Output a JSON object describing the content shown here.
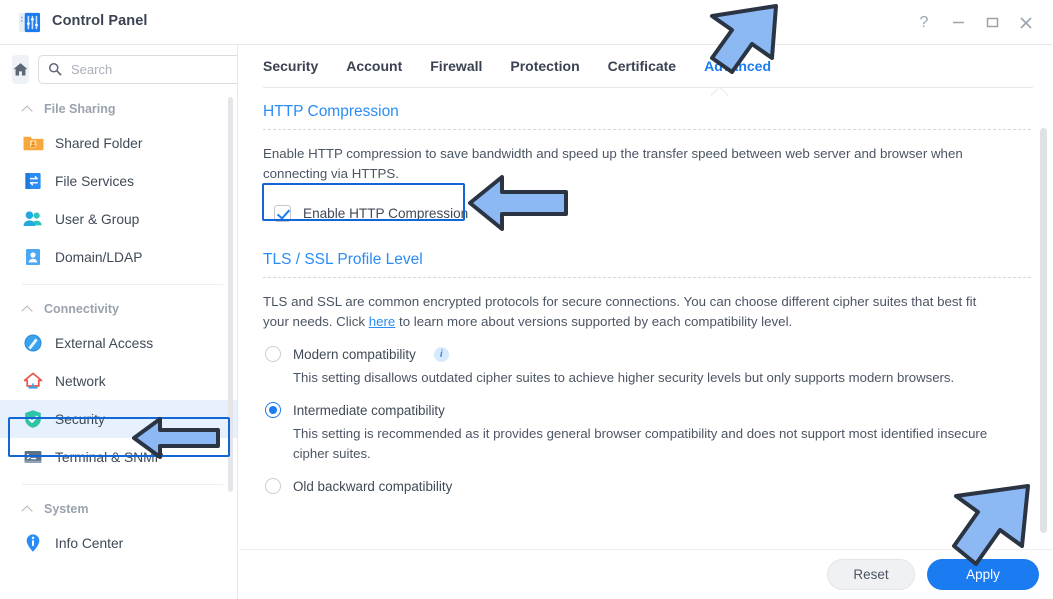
{
  "window": {
    "title": "Control Panel",
    "app_icon": "control-panel-icon",
    "controls": {
      "help": "?",
      "minimize": "minimize-icon",
      "maximize": "maximize-icon",
      "close": "close-icon"
    }
  },
  "sidebar": {
    "home_button": "home-icon",
    "search": {
      "value": "",
      "placeholder": "Search",
      "icon": "search-icon"
    },
    "groups": [
      {
        "label": "File Sharing",
        "items": [
          {
            "label": "Shared Folder",
            "icon": "shared-folder-icon",
            "active": false
          },
          {
            "label": "File Services",
            "icon": "file-services-icon",
            "active": false
          },
          {
            "label": "User & Group",
            "icon": "user-group-icon",
            "active": false
          },
          {
            "label": "Domain/LDAP",
            "icon": "domain-ldap-icon",
            "active": false
          }
        ]
      },
      {
        "label": "Connectivity",
        "items": [
          {
            "label": "External Access",
            "icon": "external-access-icon",
            "active": false
          },
          {
            "label": "Network",
            "icon": "network-icon",
            "active": false
          },
          {
            "label": "Security",
            "icon": "security-shield-icon",
            "active": true
          },
          {
            "label": "Terminal & SNMP",
            "icon": "terminal-snmp-icon",
            "active": false
          }
        ]
      },
      {
        "label": "System",
        "items": [
          {
            "label": "Info Center",
            "icon": "info-center-icon",
            "active": false
          }
        ]
      }
    ]
  },
  "main": {
    "tabs": [
      {
        "label": "Security",
        "active": false
      },
      {
        "label": "Account",
        "active": false
      },
      {
        "label": "Firewall",
        "active": false
      },
      {
        "label": "Protection",
        "active": false
      },
      {
        "label": "Certificate",
        "active": false
      },
      {
        "label": "Advanced",
        "active": true
      }
    ],
    "http_compression": {
      "title": "HTTP Compression",
      "description": "Enable HTTP compression to save bandwidth and speed up the transfer speed between web server and browser when connecting via HTTPS.",
      "checkbox_label": "Enable HTTP Compression",
      "checked": true
    },
    "tls_ssl": {
      "title": "TLS / SSL Profile Level",
      "description_part1": "TLS and SSL are common encrypted protocols for secure connections. You can choose different cipher suites that best fit your needs. Click ",
      "link_text": "here",
      "description_part2": " to learn more about versions supported by each compatibility level.",
      "options": [
        {
          "label": "Modern compatibility",
          "has_info_icon": true,
          "selected": false,
          "description": "This setting disallows outdated cipher suites to achieve higher security levels but only supports modern browsers."
        },
        {
          "label": "Intermediate compatibility",
          "has_info_icon": false,
          "selected": true,
          "description": "This setting is recommended as it provides general browser compatibility and does not support most identified insecure cipher suites."
        },
        {
          "label": "Old backward compatibility",
          "has_info_icon": false,
          "selected": false,
          "description": ""
        }
      ]
    }
  },
  "footer": {
    "reset_label": "Reset",
    "apply_label": "Apply"
  },
  "annotations": {
    "arrow_color": "#8cb8f4",
    "outline_color": "#2b3443",
    "highlight_color": "#1366d6",
    "targets": [
      "advanced-tab",
      "enable-http-compression-checkbox",
      "security-sidebar-item",
      "apply-button"
    ]
  },
  "colors": {
    "accent": "#1a7cf0",
    "section_title": "#2a8cf5",
    "text": "#3f4a56",
    "muted": "#9aa3ad",
    "active_row_bg": "#e6f1fd"
  }
}
